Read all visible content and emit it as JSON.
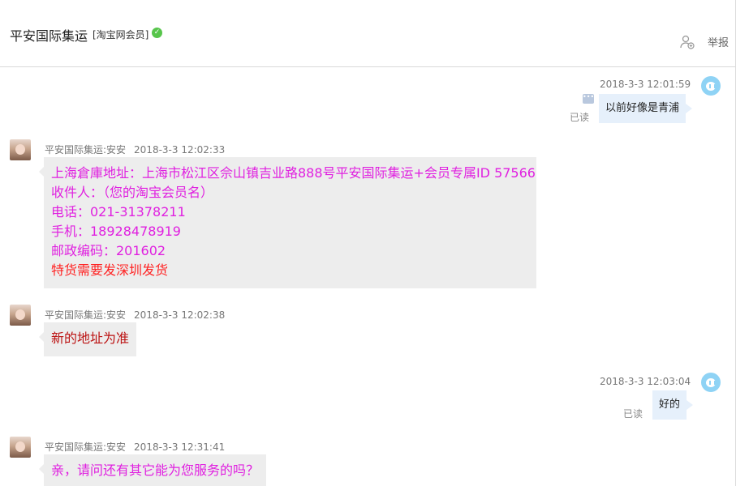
{
  "header": {
    "title": "平安国际集运",
    "member_tag": "[淘宝网会员]",
    "report_label": "举报"
  },
  "messages": [
    {
      "side": "right",
      "time": "2018-3-3 12:01:59",
      "text": "以前好像是青浦",
      "status": "已读"
    },
    {
      "side": "left",
      "sender": "平安国际集运:安安",
      "time": "2018-3-3 12:02:33",
      "lines": [
        "上海倉庫地址：上海市松江区佘山镇吉业路888号平安国际集运+会员专属ID 57566",
        "收件人：（您的淘宝会员名）",
        "电话：021-31378211",
        "手机：18928478919",
        "邮政编码：201602",
        "特货需要发深圳发货"
      ]
    },
    {
      "side": "left",
      "sender": "平安国际集运:安安",
      "time": "2018-3-3 12:02:38",
      "text": "新的地址为准"
    },
    {
      "side": "right",
      "time": "2018-3-3 12:03:04",
      "text": "好的",
      "status": "已读"
    },
    {
      "side": "left",
      "sender": "平安国际集运:安安",
      "time": "2018-3-3 12:31:41",
      "text": "亲，请问还有其它能为您服务的吗？"
    }
  ],
  "colors": {
    "magenta_text": "#e020e0",
    "red_text": "#ff2222",
    "dark_red_text": "#bb1111",
    "right_bubble": "#e6f0fb",
    "left_bubble": "#ededed",
    "verified_green": "#57c54b"
  },
  "icons": {
    "verified": "check-circle-icon",
    "add_user": "add-user-icon",
    "user_avatar": "bird-avatar-icon",
    "agent_avatar": "agent-photo-avatar",
    "message_status": "message-dots-icon"
  }
}
